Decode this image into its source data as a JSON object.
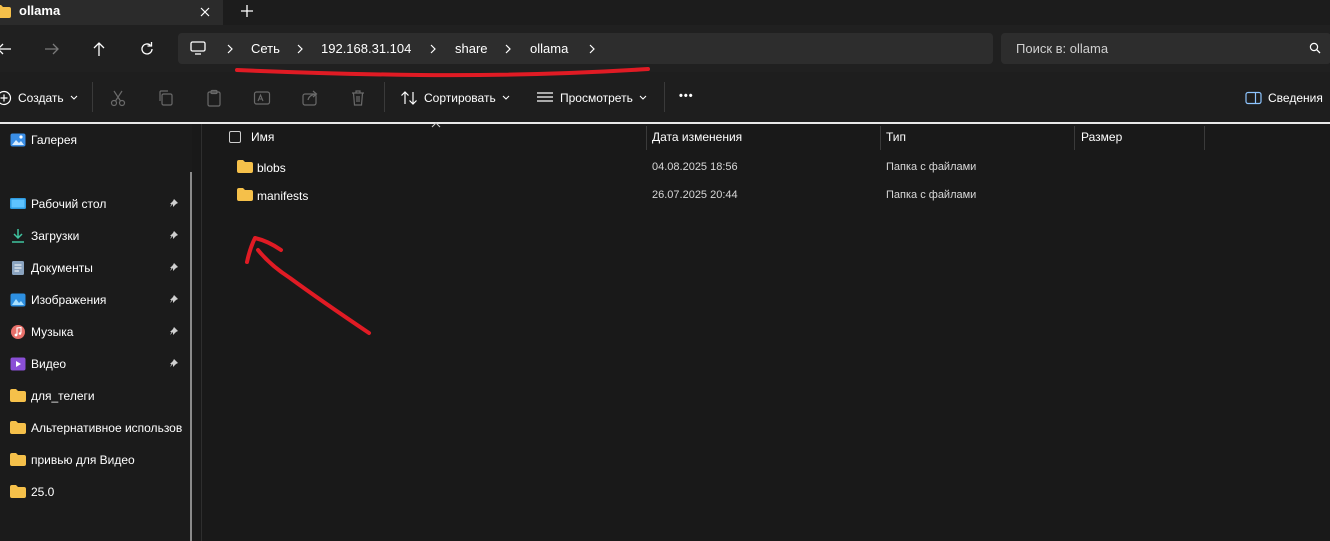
{
  "tab": {
    "title": "ollama"
  },
  "address": {
    "crumbs": [
      "Сеть",
      "192.168.31.104",
      "share",
      "ollama"
    ]
  },
  "search": {
    "placeholder": "Поиск в: ollama"
  },
  "toolbar": {
    "create_label": "Создать",
    "sort_label": "Сортировать",
    "view_label": "Просмотреть",
    "more_label": "•••",
    "details_label": "Сведения"
  },
  "sidebar": {
    "items": [
      {
        "label": "Галерея",
        "icon": "gallery-icon",
        "pinned": false
      },
      {
        "label": "Рабочий стол",
        "icon": "desktop-icon",
        "pinned": true
      },
      {
        "label": "Загрузки",
        "icon": "download-icon",
        "pinned": true
      },
      {
        "label": "Документы",
        "icon": "document-icon",
        "pinned": true
      },
      {
        "label": "Изображения",
        "icon": "pictures-icon",
        "pinned": true
      },
      {
        "label": "Музыка",
        "icon": "music-icon",
        "pinned": true
      },
      {
        "label": "Видео",
        "icon": "video-icon",
        "pinned": true
      },
      {
        "label": "для_телеги",
        "icon": "folder-icon",
        "pinned": false
      },
      {
        "label": "Альтернативное использов",
        "icon": "folder-icon",
        "pinned": false
      },
      {
        "label": "привью для Видео",
        "icon": "folder-icon",
        "pinned": false
      },
      {
        "label": "25.0",
        "icon": "folder-icon",
        "pinned": false
      }
    ]
  },
  "files": {
    "columns": [
      "Имя",
      "Дата изменения",
      "Тип",
      "Размер"
    ],
    "rows": [
      {
        "name": "blobs",
        "modified": "04.08.2025 18:56",
        "type": "Папка с файлами",
        "size": ""
      },
      {
        "name": "manifests",
        "modified": "26.07.2025 20:44",
        "type": "Папка с файлами",
        "size": ""
      }
    ]
  },
  "colors": {
    "background": "#191919",
    "address_bar": "#2d2d2d",
    "folder": "#f5c04a",
    "annotation": "#e01b24"
  }
}
